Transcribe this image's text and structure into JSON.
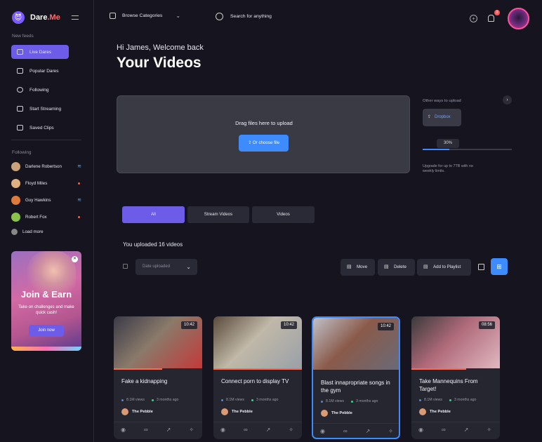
{
  "app": {
    "logo_text": "Dare",
    "logo_accent": ".Me"
  },
  "sidebar": {
    "new_feeds_label": "New feeds",
    "nav": [
      {
        "label": "Live Dares",
        "icon": "live-icon",
        "active": true
      },
      {
        "label": "Popular Dares",
        "icon": "chart-icon",
        "active": false
      },
      {
        "label": "Following",
        "icon": "user-icon",
        "active": false
      },
      {
        "label": "Start Streaming",
        "icon": "video-icon",
        "active": false
      },
      {
        "label": "Saved Clips",
        "icon": "clip-icon",
        "active": false
      }
    ],
    "following_label": "Following",
    "following": [
      {
        "name": "Darlene Robertson",
        "status": "wifi"
      },
      {
        "name": "Floyd Miles",
        "status": "live"
      },
      {
        "name": "Guy Hawkins",
        "status": "wifi"
      },
      {
        "name": "Robert Fox",
        "status": "live"
      }
    ],
    "load_more": "Load more",
    "promo": {
      "title": "Join & Earn",
      "subtitle": "Take on challenges and make quick cash!",
      "button": "Join now",
      "close": "✕"
    }
  },
  "header": {
    "browse_label": "Browse Categories",
    "search_placeholder": "Search for anything",
    "notification_count": "2"
  },
  "main": {
    "greeting": "Hi James, Welcome back",
    "title": "Your Videos",
    "upload": {
      "drop_text": "Drag files here to upload",
      "choose_button": "Or choose file",
      "other_label": "Other ways to upload",
      "dropbox_label": "Dropbox",
      "progress_label": "30%",
      "progress_value": 0.3,
      "upgrade_text": "Upgrade for up to 7TB with no weekly limits."
    },
    "tabs": [
      {
        "label": "All",
        "active": true
      },
      {
        "label": "Stream Videos",
        "active": false
      },
      {
        "label": "Videos",
        "active": false
      }
    ],
    "count_text": "You uploaded 16 videos",
    "sort_label": "Date uploaded",
    "actions": {
      "move": "Move",
      "delete": "Delete",
      "add_playlist": "Add to Playlist"
    },
    "videos": [
      {
        "title": "Fake a kidnapping",
        "duration": "10:42",
        "views": "8.1M views",
        "age": "3 months ago",
        "author": "The Pebble",
        "selected": false,
        "progress": 0.55,
        "thumb_colors": [
          "#c23a3a",
          "#3a3a48",
          "#8a7a6a"
        ]
      },
      {
        "title": "Connect porn to display TV",
        "duration": "10:42",
        "views": "8.1M views",
        "age": "3 months ago",
        "author": "The Pebble",
        "selected": false,
        "progress": 1.0,
        "thumb_colors": [
          "#9aa0a8",
          "#5a4a3a",
          "#c0b8a8"
        ]
      },
      {
        "title": "Blast innapropriate songs in the gym",
        "duration": "10:42",
        "views": "8.1M views",
        "age": "3 months ago",
        "author": "The Pebble",
        "selected": true,
        "progress": 0,
        "thumb_colors": [
          "#6a6a78",
          "#c0c0c8",
          "#8a5a4a"
        ]
      },
      {
        "title": "Take Mannequins From Target!",
        "duration": "08:56",
        "views": "8.1M views",
        "age": "3 months ago",
        "author": "The Pebble",
        "selected": false,
        "progress": 0.62,
        "thumb_colors": [
          "#e0b8c0",
          "#3a3a3a",
          "#b06a7a"
        ]
      }
    ]
  },
  "colors": {
    "accent": "#6c5ce7",
    "primary_blue": "#3d8bfd",
    "live_red": "#ff5a3c",
    "views_dot": "#3d8bfd",
    "age_dot": "#3ecf8e"
  }
}
